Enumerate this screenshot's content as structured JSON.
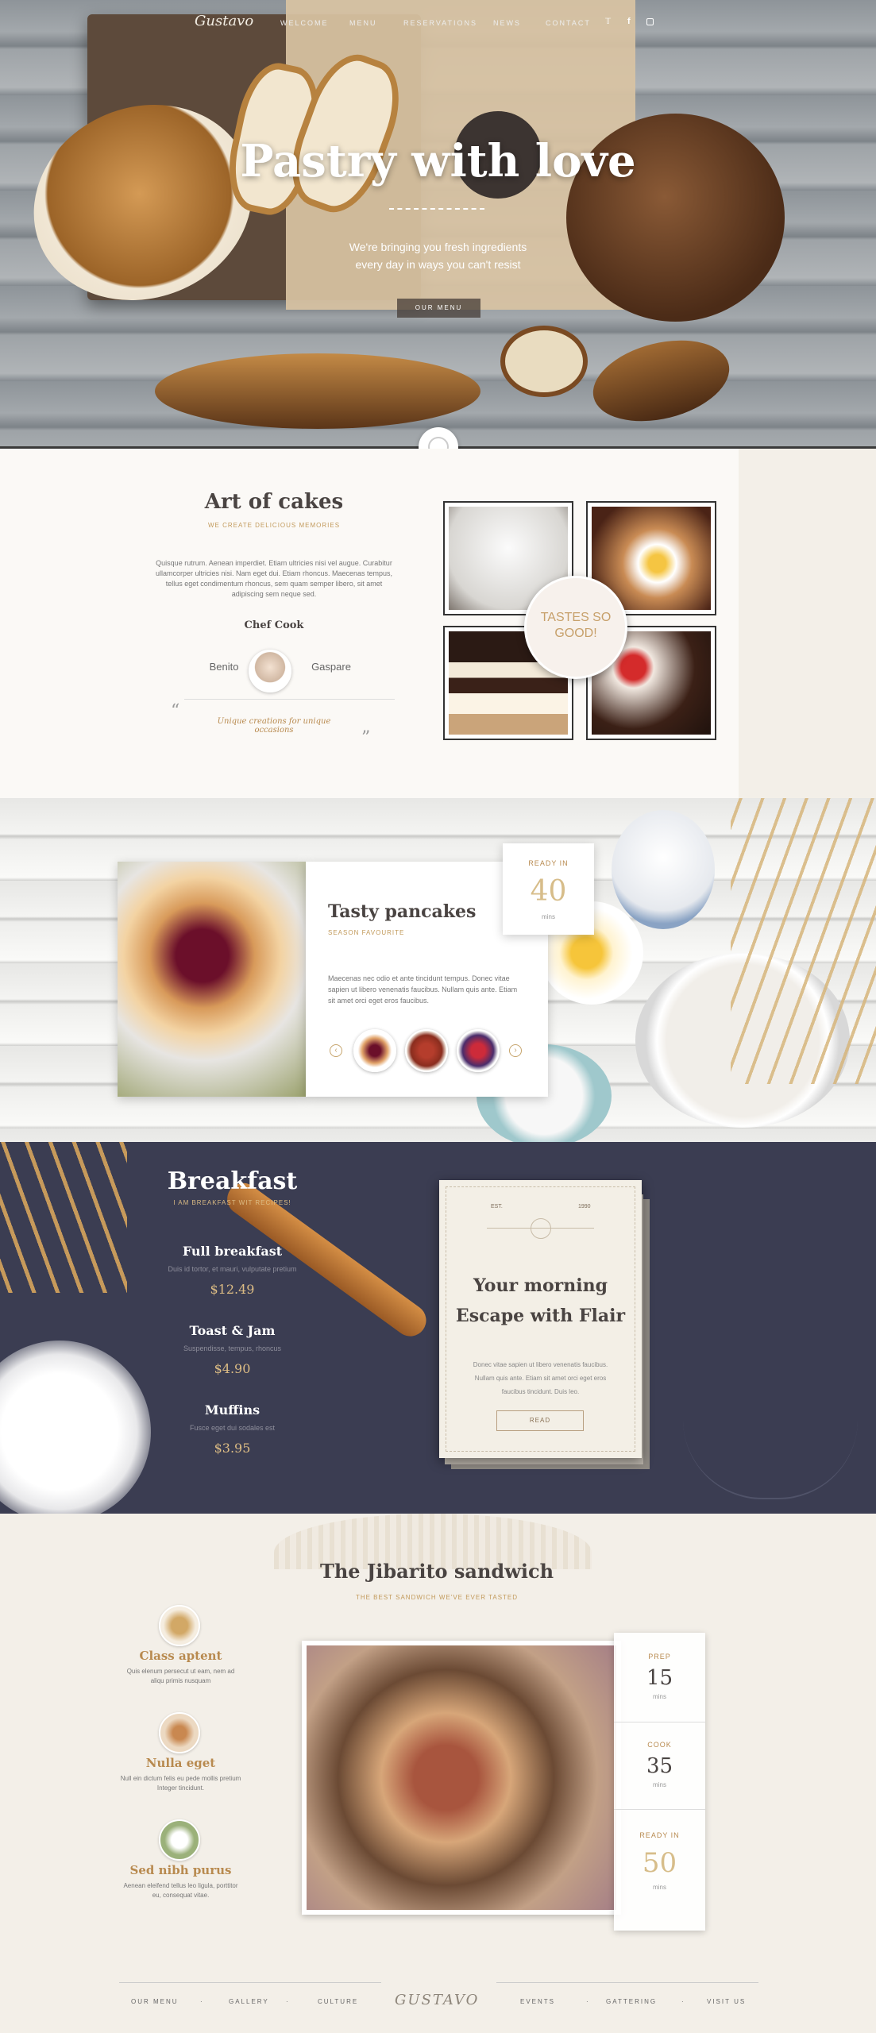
{
  "nav": {
    "logo": "Gustavo",
    "items": [
      "WELCOME",
      "MENU",
      "RESERVATIONS",
      "NEWS",
      "CONTACT"
    ],
    "social_icons": [
      "twitter-icon",
      "facebook-icon",
      "instagram-icon"
    ]
  },
  "hero": {
    "title": "Pastry with love",
    "subtitle_line1": "We're bringing you fresh ingredients",
    "subtitle_line2": "every day in ways you can't resist",
    "button": "OUR MENU"
  },
  "art_of_cakes": {
    "title": "Art of cakes",
    "subtitle": "WE CREATE DELICIOUS MEMORIES",
    "body": "Quisque rutrum. Aenean imperdiet. Etiam ultricies nisi vel augue. Curabitur ullamcorper ultricies nisi. Nam eget dui. Etiam rhoncus. Maecenas tempus, tellus eget condimentum rhoncus, sem quam semper libero, sit amet adipiscing sem neque sed.",
    "chef_label": "Chef Cook",
    "chef_first": "Benito",
    "chef_last": "Gaspare",
    "quote": "Unique creations for unique occasions",
    "badge_line1": "TASTES SO",
    "badge_line2": "GOOD!"
  },
  "pancakes": {
    "title": "Tasty pancakes",
    "subtitle": "SEASON FAVOURITE",
    "body": "Maecenas nec odio et ante tincidunt tempus. Donec vitae sapien ut libero venenatis faucibus. Nullam quis ante. Etiam sit amet orci eget eros faucibus.",
    "ready_label": "READY IN",
    "ready_value": "40",
    "ready_unit": "mins"
  },
  "breakfast": {
    "title": "Breakfast",
    "subtitle": "I AM BREAKFAST WIT RECIPES!",
    "items": [
      {
        "name": "Full breakfast",
        "desc": "Duis id tortor, et mauri, vulputate pretium",
        "price": "$12.49"
      },
      {
        "name": "Toast & Jam",
        "desc": "Suspendisse, tempus, rhoncus",
        "price": "$4.90"
      },
      {
        "name": "Muffins",
        "desc": "Fusce eget dui sodales est",
        "price": "$3.95"
      }
    ],
    "card": {
      "est": "EST.",
      "year": "1990",
      "title_line1": "Your morning",
      "title_line2": "Escape with Flair",
      "body_line1": "Donec vitae sapien ut libero venenatis faucibus.",
      "body_line2": "Nullam quis ante. Etiam sit amet orci eget eros",
      "body_line3": "faucibus tincidunt. Duis leo.",
      "button": "READ"
    }
  },
  "jibarito": {
    "title": "The Jibarito sandwich",
    "subtitle": "THE BEST SANDWICH WE'VE EVER TASTED",
    "features": [
      {
        "icon": "wheat-icon",
        "title": "Class aptent",
        "desc_line1": "Quis elenum persecut ut eam, nem ad",
        "desc_line2": "aliqu primis nusquam"
      },
      {
        "icon": "eggs-icon",
        "title": "Nulla eget",
        "desc_line1": "Null ein dictum felis eu pede mollis pretium",
        "desc_line2": "Integer tincidunt."
      },
      {
        "icon": "garlic-icon",
        "title": "Sed nibh purus",
        "desc_line1": "Aenean eleifend tellus leo ligula, porttitor",
        "desc_line2": "eu, consequat vitae."
      }
    ],
    "stats": [
      {
        "label": "PREP",
        "value": "15",
        "unit": "mins"
      },
      {
        "label": "COOK",
        "value": "35",
        "unit": "mins"
      },
      {
        "label": "READY IN",
        "value": "50",
        "unit": "mins"
      }
    ]
  },
  "footer": {
    "left": [
      "OUR MENU",
      "GALLERY",
      "CULTURE"
    ],
    "logo": "GUSTAVO",
    "right": [
      "EVENTS",
      "GATTERING",
      "VISIT US"
    ]
  }
}
